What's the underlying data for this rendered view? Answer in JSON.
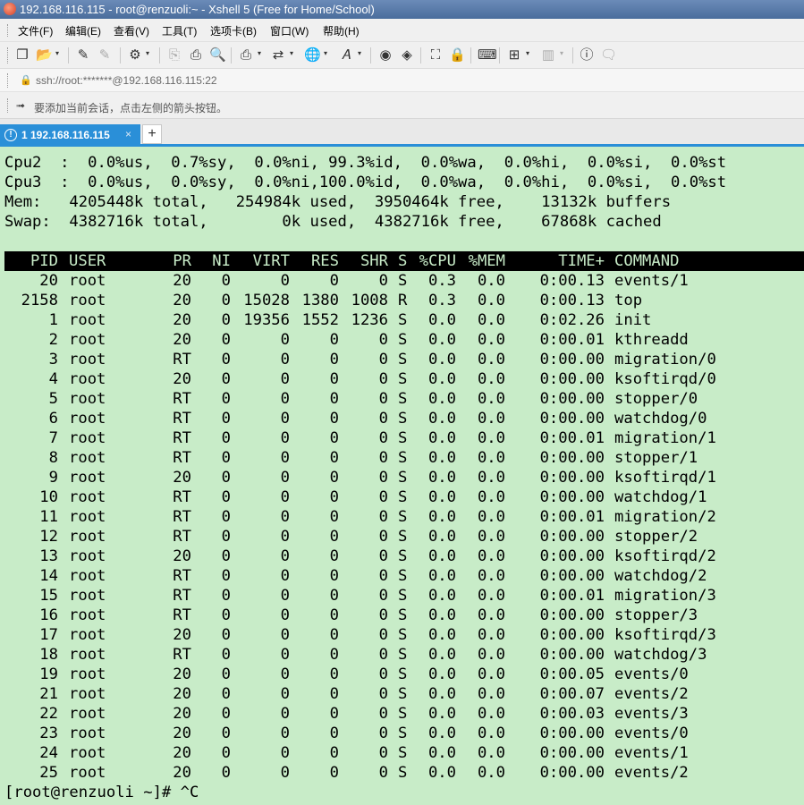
{
  "window": {
    "title": "192.168.116.115 - root@renzuoli:~ - Xshell 5 (Free for Home/School)"
  },
  "menu": [
    "文件(F)",
    "编辑(E)",
    "查看(V)",
    "工具(T)",
    "选项卡(B)",
    "窗口(W)",
    "帮助(H)"
  ],
  "toolbar": {
    "icons": [
      "new-session-icon",
      "open-folder-icon",
      "connect-icon",
      "disconnect-icon",
      "properties-icon",
      "copy-icon",
      "paste-icon",
      "find-icon",
      "print-icon",
      "transfer-icon",
      "globe-icon",
      "font-icon",
      "xftp-icon",
      "xmanager-icon",
      "fullscreen-icon",
      "lock-icon",
      "keyboard-icon",
      "add-tab-icon",
      "layout-icon",
      "help-icon",
      "chat-icon"
    ]
  },
  "address": {
    "text": "ssh://root:*******@192.168.116.115:22"
  },
  "hint": {
    "text": "要添加当前会话，点击左侧的箭头按钮。"
  },
  "tab": {
    "label": "1 192.168.116.115",
    "close": "×",
    "new": "+"
  },
  "terminal": {
    "summary": [
      "Cpu2  :  0.0%us,  0.7%sy,  0.0%ni, 99.3%id,  0.0%wa,  0.0%hi,  0.0%si,  0.0%st",
      "Cpu3  :  0.0%us,  0.0%sy,  0.0%ni,100.0%id,  0.0%wa,  0.0%hi,  0.0%si,  0.0%st",
      "Mem:   4205448k total,   254984k used,  3950464k free,    13132k buffers",
      "Swap:  4382716k total,        0k used,  4382716k free,    67868k cached"
    ],
    "columns": [
      "PID",
      "USER",
      "PR",
      "NI",
      "VIRT",
      "RES",
      "SHR",
      "S",
      "%CPU",
      "%MEM",
      "TIME+",
      "COMMAND"
    ],
    "processes": [
      [
        "20",
        "root",
        "20",
        "0",
        "0",
        "0",
        "0",
        "S",
        "0.3",
        "0.0",
        "0:00.13",
        "events/1"
      ],
      [
        "2158",
        "root",
        "20",
        "0",
        "15028",
        "1380",
        "1008",
        "R",
        "0.3",
        "0.0",
        "0:00.13",
        "top"
      ],
      [
        "1",
        "root",
        "20",
        "0",
        "19356",
        "1552",
        "1236",
        "S",
        "0.0",
        "0.0",
        "0:02.26",
        "init"
      ],
      [
        "2",
        "root",
        "20",
        "0",
        "0",
        "0",
        "0",
        "S",
        "0.0",
        "0.0",
        "0:00.01",
        "kthreadd"
      ],
      [
        "3",
        "root",
        "RT",
        "0",
        "0",
        "0",
        "0",
        "S",
        "0.0",
        "0.0",
        "0:00.00",
        "migration/0"
      ],
      [
        "4",
        "root",
        "20",
        "0",
        "0",
        "0",
        "0",
        "S",
        "0.0",
        "0.0",
        "0:00.00",
        "ksoftirqd/0"
      ],
      [
        "5",
        "root",
        "RT",
        "0",
        "0",
        "0",
        "0",
        "S",
        "0.0",
        "0.0",
        "0:00.00",
        "stopper/0"
      ],
      [
        "6",
        "root",
        "RT",
        "0",
        "0",
        "0",
        "0",
        "S",
        "0.0",
        "0.0",
        "0:00.00",
        "watchdog/0"
      ],
      [
        "7",
        "root",
        "RT",
        "0",
        "0",
        "0",
        "0",
        "S",
        "0.0",
        "0.0",
        "0:00.01",
        "migration/1"
      ],
      [
        "8",
        "root",
        "RT",
        "0",
        "0",
        "0",
        "0",
        "S",
        "0.0",
        "0.0",
        "0:00.00",
        "stopper/1"
      ],
      [
        "9",
        "root",
        "20",
        "0",
        "0",
        "0",
        "0",
        "S",
        "0.0",
        "0.0",
        "0:00.00",
        "ksoftirqd/1"
      ],
      [
        "10",
        "root",
        "RT",
        "0",
        "0",
        "0",
        "0",
        "S",
        "0.0",
        "0.0",
        "0:00.00",
        "watchdog/1"
      ],
      [
        "11",
        "root",
        "RT",
        "0",
        "0",
        "0",
        "0",
        "S",
        "0.0",
        "0.0",
        "0:00.01",
        "migration/2"
      ],
      [
        "12",
        "root",
        "RT",
        "0",
        "0",
        "0",
        "0",
        "S",
        "0.0",
        "0.0",
        "0:00.00",
        "stopper/2"
      ],
      [
        "13",
        "root",
        "20",
        "0",
        "0",
        "0",
        "0",
        "S",
        "0.0",
        "0.0",
        "0:00.00",
        "ksoftirqd/2"
      ],
      [
        "14",
        "root",
        "RT",
        "0",
        "0",
        "0",
        "0",
        "S",
        "0.0",
        "0.0",
        "0:00.00",
        "watchdog/2"
      ],
      [
        "15",
        "root",
        "RT",
        "0",
        "0",
        "0",
        "0",
        "S",
        "0.0",
        "0.0",
        "0:00.01",
        "migration/3"
      ],
      [
        "16",
        "root",
        "RT",
        "0",
        "0",
        "0",
        "0",
        "S",
        "0.0",
        "0.0",
        "0:00.00",
        "stopper/3"
      ],
      [
        "17",
        "root",
        "20",
        "0",
        "0",
        "0",
        "0",
        "S",
        "0.0",
        "0.0",
        "0:00.00",
        "ksoftirqd/3"
      ],
      [
        "18",
        "root",
        "RT",
        "0",
        "0",
        "0",
        "0",
        "S",
        "0.0",
        "0.0",
        "0:00.00",
        "watchdog/3"
      ],
      [
        "19",
        "root",
        "20",
        "0",
        "0",
        "0",
        "0",
        "S",
        "0.0",
        "0.0",
        "0:00.05",
        "events/0"
      ],
      [
        "21",
        "root",
        "20",
        "0",
        "0",
        "0",
        "0",
        "S",
        "0.0",
        "0.0",
        "0:00.07",
        "events/2"
      ],
      [
        "22",
        "root",
        "20",
        "0",
        "0",
        "0",
        "0",
        "S",
        "0.0",
        "0.0",
        "0:00.03",
        "events/3"
      ],
      [
        "23",
        "root",
        "20",
        "0",
        "0",
        "0",
        "0",
        "S",
        "0.0",
        "0.0",
        "0:00.00",
        "events/0"
      ],
      [
        "24",
        "root",
        "20",
        "0",
        "0",
        "0",
        "0",
        "S",
        "0.0",
        "0.0",
        "0:00.00",
        "events/1"
      ],
      [
        "25",
        "root",
        "20",
        "0",
        "0",
        "0",
        "0",
        "S",
        "0.0",
        "0.0",
        "0:00.00",
        "events/2"
      ]
    ],
    "prompt": "[root@renzuoli ~]# ^C"
  },
  "colors": {
    "terminal_bg": "#c8ecc8",
    "header_bg": "#000000",
    "tab_accent": "#2a8fd8"
  }
}
